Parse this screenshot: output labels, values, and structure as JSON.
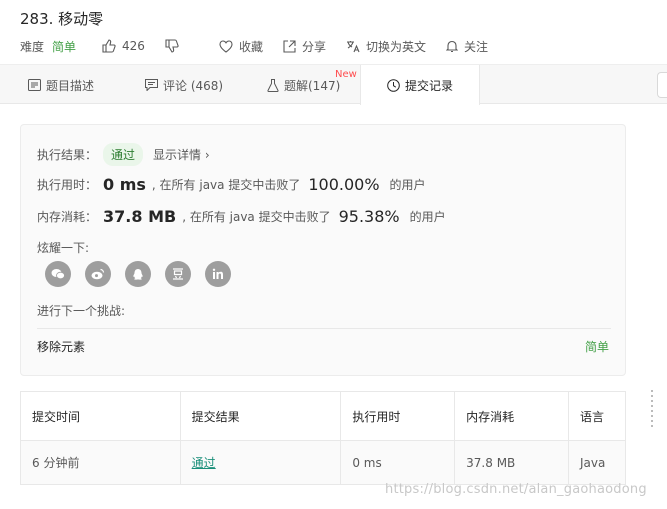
{
  "problem": {
    "title": "283. 移动零",
    "difficulty_label": "难度",
    "difficulty": "简单",
    "likes": "426",
    "favorite_label": "收藏",
    "share_label": "分享",
    "translate_label": "切换为英文",
    "follow_label": "关注"
  },
  "tabs": [
    {
      "label": "题目描述",
      "icon": "description-icon"
    },
    {
      "label": "评论 (468)",
      "icon": "comment-icon"
    },
    {
      "label": "题解(147)",
      "icon": "flask-icon",
      "badge": "New"
    },
    {
      "label": "提交记录",
      "icon": "clock-icon"
    }
  ],
  "result": {
    "status_label": "执行结果：",
    "status": "通过",
    "detail_link": "显示详情 ›",
    "runtime_label": "执行用时：",
    "runtime": "0 ms",
    "runtime_text": ", 在所有 java 提交中击败了",
    "runtime_pct": "100.00%",
    "runtime_suffix": "的用户",
    "memory_label": "内存消耗：",
    "memory": "37.8 MB",
    "memory_text": ", 在所有 java 提交中击败了",
    "memory_pct": "95.38%",
    "memory_suffix": "的用户",
    "share_label": "炫耀一下:",
    "share_icons": [
      {
        "name": "wechat-icon",
        "glyph": "✉"
      },
      {
        "name": "weibo-icon",
        "glyph": "◉"
      },
      {
        "name": "qq-icon",
        "glyph": "♟"
      },
      {
        "name": "douban-icon",
        "glyph": "豆"
      },
      {
        "name": "linkedin-icon",
        "glyph": "in"
      }
    ],
    "next_label": "进行下一个挑战:",
    "next_problem": "移除元素",
    "next_difficulty": "简单"
  },
  "submissions": {
    "headers": [
      "提交时间",
      "提交结果",
      "执行用时",
      "内存消耗",
      "语言"
    ],
    "rows": [
      {
        "time": "6 分钟前",
        "result": "通过",
        "runtime": "0 ms",
        "memory": "37.8 MB",
        "lang": "Java"
      }
    ]
  },
  "watermark": "https://blog.csdn.net/alan_gaohaodong",
  "colors": {
    "accent_green": "#43a047",
    "pass_bg": "#eaf6ea",
    "link_teal": "#1a8f7a",
    "new_red": "#ff4d4f"
  }
}
